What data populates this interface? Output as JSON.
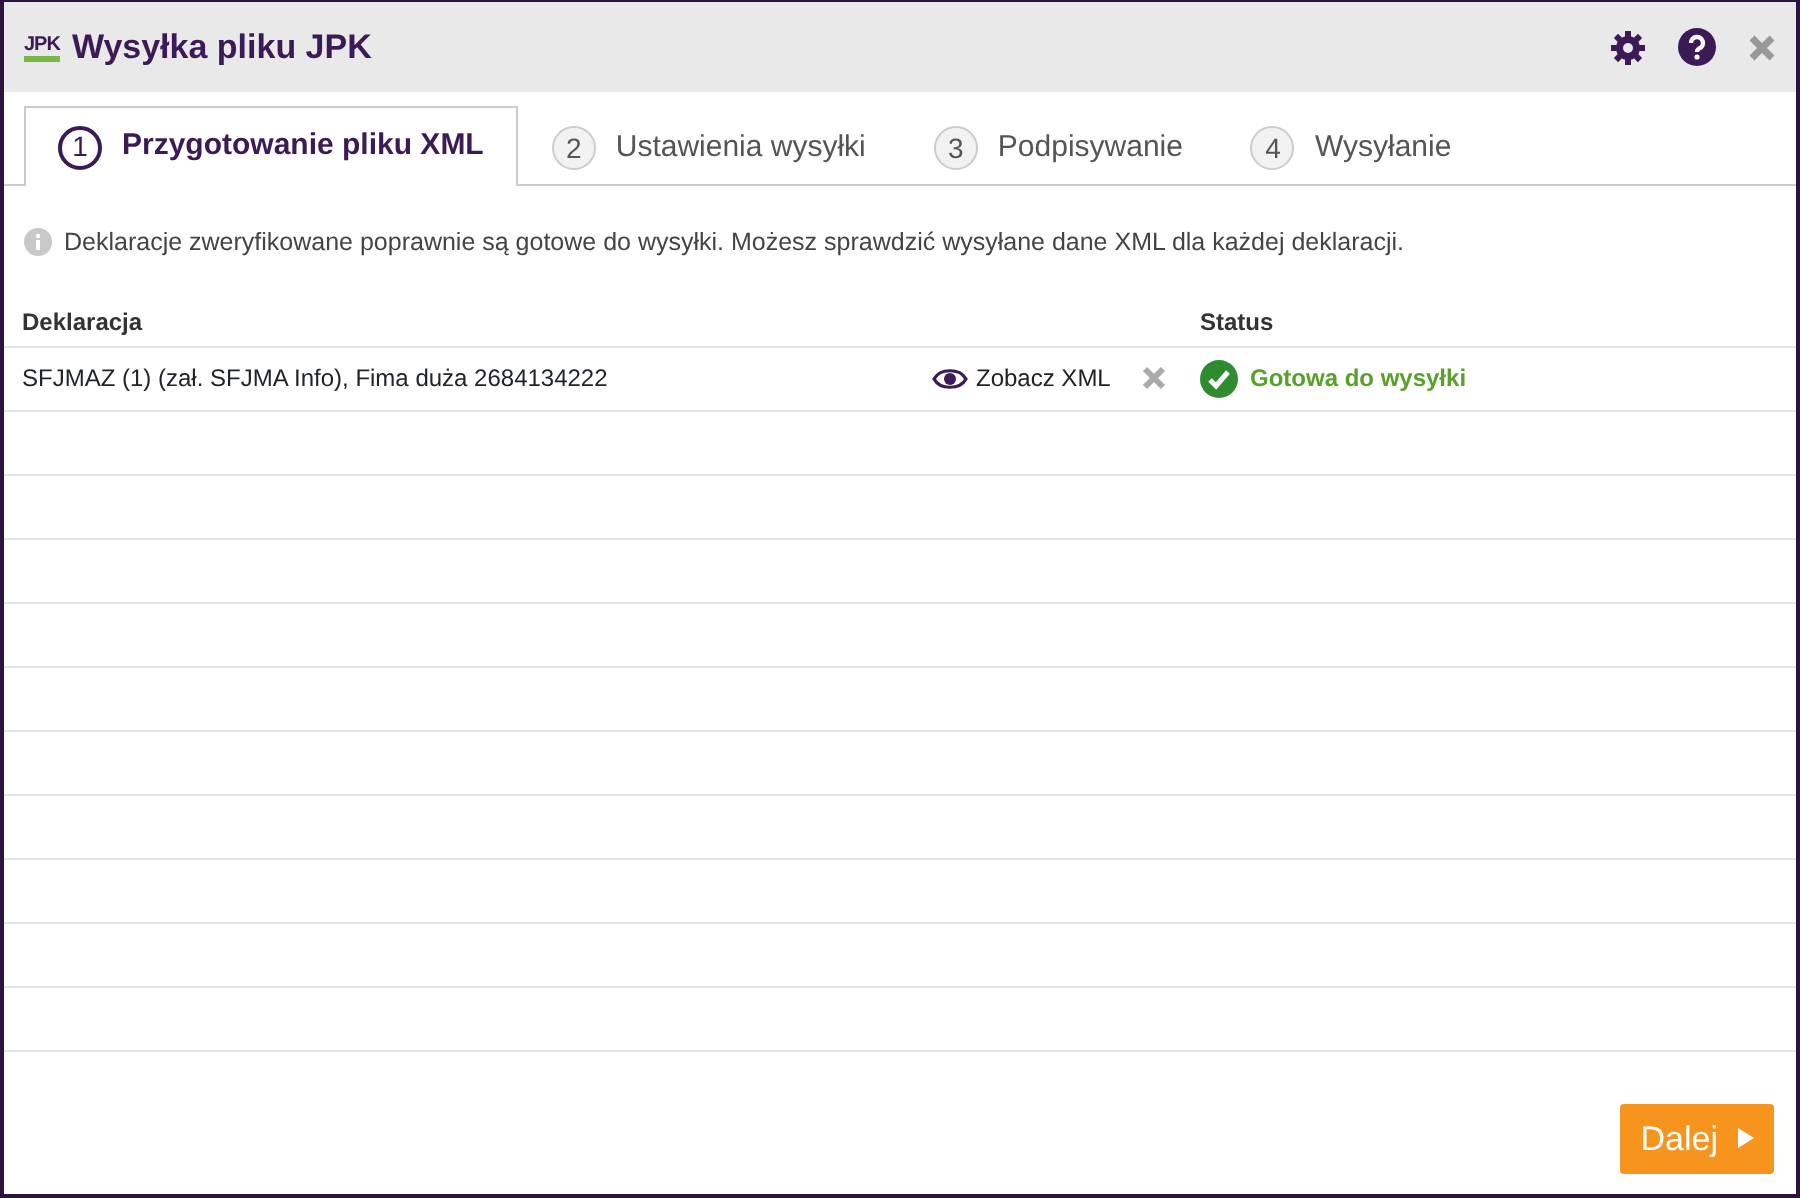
{
  "window": {
    "logo_text": "JPK",
    "title": "Wysyłka pliku JPK"
  },
  "steps": [
    {
      "number": "1",
      "label": "Przygotowanie pliku XML",
      "selected": true
    },
    {
      "number": "2",
      "label": "Ustawienia wysyłki",
      "selected": false
    },
    {
      "number": "3",
      "label": "Podpisywanie",
      "selected": false
    },
    {
      "number": "4",
      "label": "Wysyłanie",
      "selected": false
    }
  ],
  "info": "Deklaracje zweryfikowane poprawnie są gotowe do wysyłki. Możesz sprawdzić wysyłane dane XML dla każdej deklaracji.",
  "table": {
    "columns": [
      "Deklaracja",
      "Status"
    ],
    "rows": [
      {
        "name": "SFJMAZ (1) (zał. SFJMA Info), Fima duża 2684134222",
        "action": "Zobacz XML",
        "status": "Gotowa do wysyłki"
      }
    ]
  },
  "next_button": "Dalej"
}
